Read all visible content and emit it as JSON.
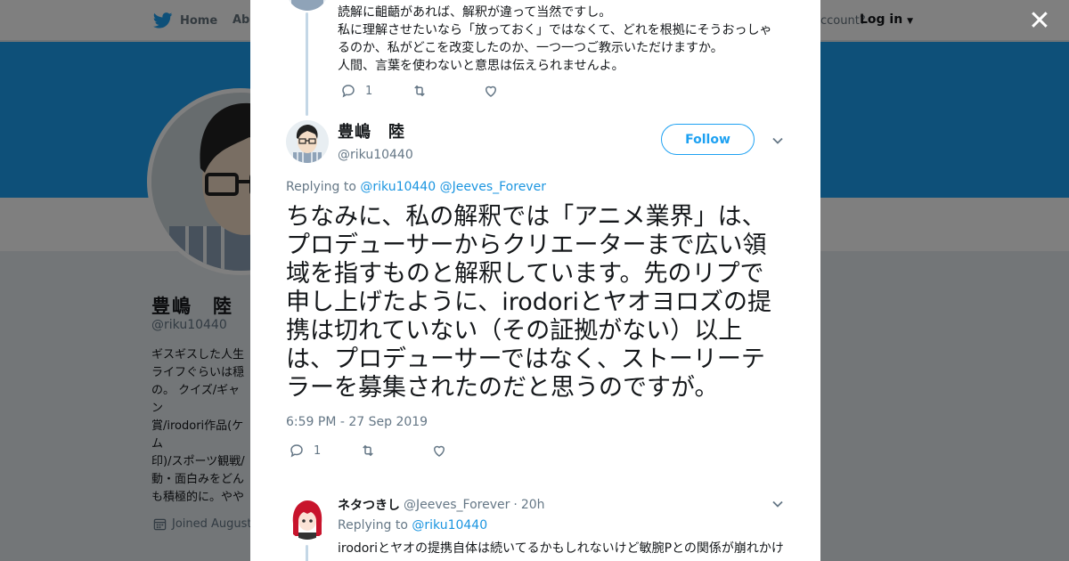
{
  "topbar": {
    "home_label": "Home",
    "about_label": "Abo",
    "account_text": "ccount?",
    "login_label": "Log in"
  },
  "profile": {
    "name": "豊嶋　陸",
    "handle": "@riku10440",
    "bio": "ギスギスした人生\nライフぐらいは穏\nの。 クイズ/ギャン\n賞/irodori作品(ケム\n印)/スポーツ観戦/\n動・面白みをどん\nも積極的に。やや\nクorミュート。喧\nうんざり。",
    "joined": "Joined August"
  },
  "previous_tweet": {
    "lines": [
      "読解に齟齬があれば、解釈が違って当然ですし。",
      "私に理解させたいなら「放っておく」ではなくて、どれを根拠にそうおっしゃ",
      "るのか、私がどこを改変したのか、一つ一つご教示いただけますか。",
      "人間、言葉を使わないと意思は伝えられませんよ。"
    ],
    "reply_count": "1"
  },
  "main_tweet": {
    "name": "豊嶋　陸",
    "handle": "@riku10440",
    "follow_label": "Follow",
    "replying_prefix": "Replying to",
    "replying_to_1": "@riku10440",
    "replying_to_2": "@Jeeves_Forever",
    "lines": [
      "ちなみに、私の解釈では「アニメ業界」は、",
      "プロデューサーからクリエーターまで広い領",
      "域を指すものと解釈しています。先のリプで",
      "申し上げたように、irodoriとヤオヨロズの提",
      "携は切れていない（その証拠がない）以上",
      "は、プロデューサーではなく、ストーリーテ",
      "ラーを募集されたのだと思うのですが。"
    ],
    "timestamp": "6:59 PM - 27 Sep 2019",
    "reply_count": "1"
  },
  "reply_tweet": {
    "name": "ネタつきし",
    "handle": "@Jeeves_Forever",
    "separator": "·",
    "time": "20h",
    "replying_prefix": "Replying to",
    "replying_to": "@riku10440",
    "lines": [
      "irodoriとヤオの提携自体は続いてるかもしれないけど敏腕Pとの関係が崩れかけ"
    ]
  },
  "colors": {
    "brand_blue": "#1da1f2",
    "link_blue": "#1b95e0",
    "thread_line": "#c4d7e6"
  },
  "icons": {
    "close": "close-icon",
    "reply": "reply-icon",
    "retweet": "retweet-icon",
    "like": "heart-icon",
    "more": "chevron-down-icon"
  }
}
